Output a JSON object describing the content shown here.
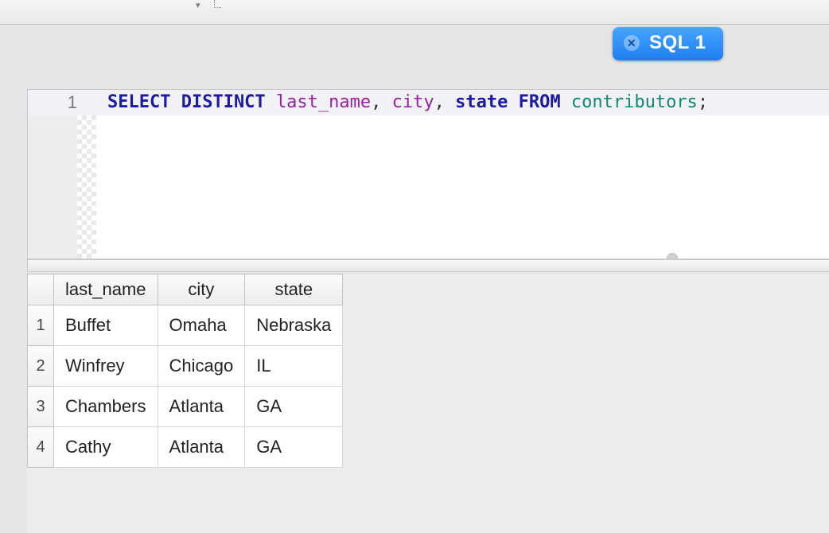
{
  "tab": {
    "label": "SQL 1",
    "close_glyph": "✕"
  },
  "editor": {
    "line_no": "1",
    "tokens": {
      "kw1": "SELECT DISTINCT",
      "id_lastname": "last_name",
      "comma1": ",",
      "id_city": "city",
      "comma2": ",",
      "kw_state": "state",
      "kw_from": "FROM",
      "id_table": "contributors",
      "semi": ";"
    }
  },
  "results": {
    "columns": [
      "last_name",
      "city",
      "state"
    ],
    "rows": [
      {
        "n": "1",
        "c0": "Buffet",
        "c1": "Omaha",
        "c2": "Nebraska"
      },
      {
        "n": "2",
        "c0": "Winfrey",
        "c1": "Chicago",
        "c2": "IL"
      },
      {
        "n": "3",
        "c0": "Chambers",
        "c1": "Atlanta",
        "c2": "GA"
      },
      {
        "n": "4",
        "c0": "Cathy",
        "c1": "Atlanta",
        "c2": "GA"
      }
    ]
  }
}
